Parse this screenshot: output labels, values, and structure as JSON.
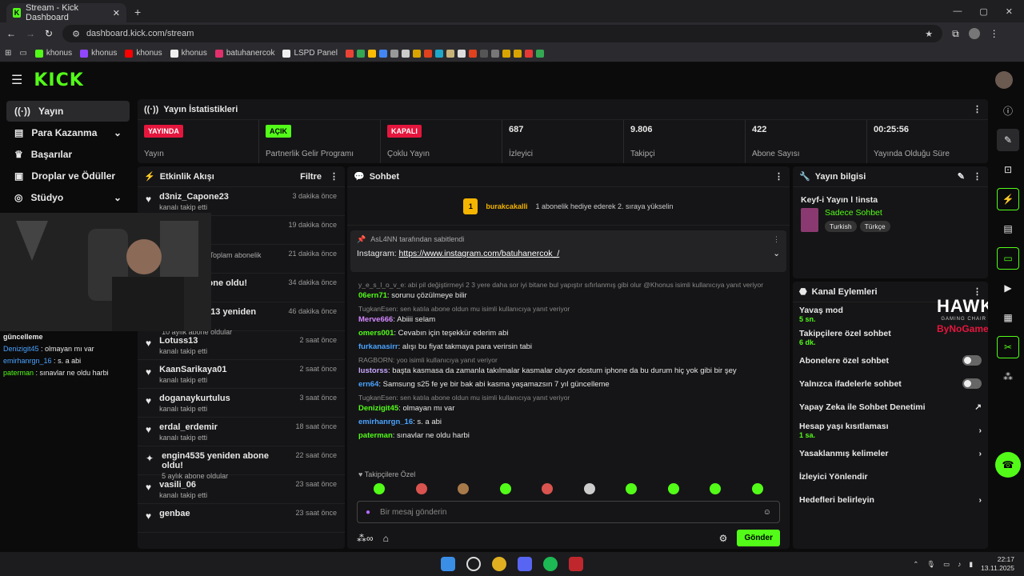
{
  "browser": {
    "tab_title": "Stream - Kick Dashboard",
    "url": "dashboard.kick.com/stream",
    "bookmarks": [
      "khonus",
      "khonus",
      "khonus",
      "khonus",
      "batuhanercok",
      "LSPD Panel"
    ]
  },
  "sidebar": {
    "items": [
      {
        "label": "Yayın",
        "icon": "broadcast-icon"
      },
      {
        "label": "Para Kazanma",
        "icon": "money-icon"
      },
      {
        "label": "Başarılar",
        "icon": "trophy-icon"
      },
      {
        "label": "Droplar ve Ödüller",
        "icon": "gift-icon"
      },
      {
        "label": "Stüdyo",
        "icon": "studio-icon"
      }
    ]
  },
  "stats": {
    "title": "Yayın İstatistikleri",
    "items": [
      {
        "badge": "YAYINDA",
        "badge_color": "#e5163d",
        "label": "Yayın"
      },
      {
        "badge": "AÇIK",
        "badge_color": "#53fc18",
        "label": "Partnerlik Gelir Programı"
      },
      {
        "badge": "KAPALI",
        "badge_color": "#e5163d",
        "label": "Çoklu Yayın"
      },
      {
        "value": "687",
        "label": "İzleyici"
      },
      {
        "value": "9.806",
        "label": "Takipçi"
      },
      {
        "value": "422",
        "label": "Abone Sayısı"
      },
      {
        "value": "00:25:56",
        "label": "Yayında Olduğu Süre"
      }
    ]
  },
  "activity": {
    "title": "Etkinlik Akışı",
    "filter": "Filtre",
    "items": [
      {
        "name": "d3niz_Capone23",
        "sub": "kanalı takip etti",
        "time": "3 dakika önce"
      },
      {
        "name": "",
        "sub": "",
        "time": "19 dakika önce"
      },
      {
        "name": "",
        "sub": "nesini kutluyor! Toplam abonelik süresi -",
        "time": "21 dakika önce"
      },
      {
        "name": "yeniden abone oldu!",
        "sub": "oldular",
        "time": "34 dakika önce"
      },
      {
        "name": "Ekin_Boran13 yeniden abone oldu!",
        "sub": "10 aylık abone oldular",
        "time": "46 dakika önce"
      },
      {
        "name": "Lotuss13",
        "sub": "kanalı takip etti",
        "time": "2 saat önce"
      },
      {
        "name": "KaanSarikaya01",
        "sub": "kanalı takip etti",
        "time": "2 saat önce"
      },
      {
        "name": "doganaykurtulus",
        "sub": "kanalı takip etti",
        "time": "3 saat önce"
      },
      {
        "name": "erdal_erdemir",
        "sub": "kanalı takip etti",
        "time": "18 saat önce"
      },
      {
        "name": "engin4535 yeniden abone oldu!",
        "sub": "5 aylık abone oldular",
        "time": "22 saat önce"
      },
      {
        "name": "vasili_06",
        "sub": "kanalı takip etti",
        "time": "23 saat önce"
      },
      {
        "name": "genbae",
        "sub": "",
        "time": "23 saat önce"
      }
    ]
  },
  "chat": {
    "title": "Sohbet",
    "top_gifter": "burakcakalli",
    "top_rank": "1",
    "gift_hint": "1 abonelik hediye ederek 2. sıraya yükselin",
    "pinned_by": "AsL4NN tarafından sabitlendi",
    "pinned_label": "Instagram:",
    "pinned_link": "https://www.instagram.com/batuhanercok_/",
    "messages": [
      {
        "reply": "y_e_s_l_o_v_e: abi pil değiştirmeyi 2 3 yere daha sor iyi bitane bul yapıştır sıfırlanmış gibi olur @Khonus isimli kullanıcıya yanıt veriyor",
        "user": "06ern71",
        "color": "#53fc18",
        "text": "sorunu çözülmeye bilir"
      },
      {
        "reply": "TugkanEsen: sen katıla abone oldun mu isimli kullanıcıya yanıt veriyor",
        "user": "Merve666",
        "color": "#d488ff",
        "text": "Abiiii selam"
      },
      {
        "reply": "",
        "user": "omers001",
        "color": "#53fc18",
        "text": "Cevabın için teşekkür ederim abi"
      },
      {
        "reply": "",
        "user": "furkanasirr",
        "color": "#4aa3ff",
        "text": "alışı bu fiyat takmaya para verirsin tabi"
      },
      {
        "reply": "RAGBORN: yoo isimli kullanıcıya yanıt veriyor",
        "user": "lustorss",
        "color": "#c9a8ff",
        "text": "başta kasmasa da zamanla takılmalar kasmalar oluyor dostum iphone da bu durum hiç yok gibi bir şey"
      },
      {
        "reply": "",
        "user": "ern64",
        "color": "#4aa3ff",
        "text": "Samsung s25 fe ye bir bak abi kasma yaşamazsın 7 yıl güncelleme"
      },
      {
        "reply": "TugkanEsen: sen katıla abone oldun mu isimli kullanıcıya yanıt veriyor",
        "user": "Denizigit45",
        "color": "#53fc18",
        "text": "olmayan mı var"
      },
      {
        "reply": "",
        "user": "emirhanrgn_16",
        "color": "#4aa3ff",
        "text": "s. a abi"
      },
      {
        "reply": "",
        "user": "paterman",
        "color": "#53fc18",
        "text": "sınavlar ne oldu harbi"
      }
    ],
    "followers_only": "Takipçilere Özel",
    "input_placeholder": "Bir mesaj gönderin",
    "send_label": "Gönder"
  },
  "streaminfo": {
    "title": "Yayın bilgisi",
    "stream_title": "Keyf-i Yayın l !insta",
    "category": "Sadece Sohbet",
    "tags": [
      "Turkish",
      "Türkçe"
    ]
  },
  "channel": {
    "title": "Kanal Eylemleri",
    "rows": [
      {
        "label": "Yavaş mod",
        "sub": "5 sn.",
        "control": "none"
      },
      {
        "label": "Takipçilere özel sohbet",
        "sub": "6 dk.",
        "control": "none"
      },
      {
        "label": "Abonelere özel sohbet",
        "sub": "",
        "control": "toggle"
      },
      {
        "label": "Yalnızca ifadelerle sohbet",
        "sub": "",
        "control": "toggle"
      },
      {
        "label": "Yapay Zeka ile Sohbet Denetimi",
        "sub": "",
        "control": "external"
      },
      {
        "label": "Hesap yaşı kısıtlaması",
        "sub": "1 sa.",
        "control": "chevron"
      },
      {
        "label": "Yasaklanmış kelimeler",
        "sub": "",
        "control": "chevron"
      },
      {
        "label": "İzleyici Yönlendir",
        "sub": "",
        "control": "none"
      },
      {
        "label": "Hedefleri belirleyin",
        "sub": "",
        "control": "chevron"
      }
    ]
  },
  "overlay": {
    "heading": "güncelleme",
    "lines": [
      {
        "user": "Denizigit45",
        "color": "#4aa3ff",
        "text": "olmayan mı var"
      },
      {
        "user": "emirhanrgn_16",
        "color": "#4aa3ff",
        "text": "s. a abi"
      },
      {
        "user": "paterman",
        "color": "#53fc18",
        "text": "sınavlar ne oldu harbi"
      }
    ],
    "sponsor_1": "HAWK",
    "sponsor_1_sub": "GAMING CHAIR",
    "sponsor_2": "ByNoGame"
  },
  "taskbar": {
    "time": "22:17",
    "date": "13.11.2025"
  }
}
